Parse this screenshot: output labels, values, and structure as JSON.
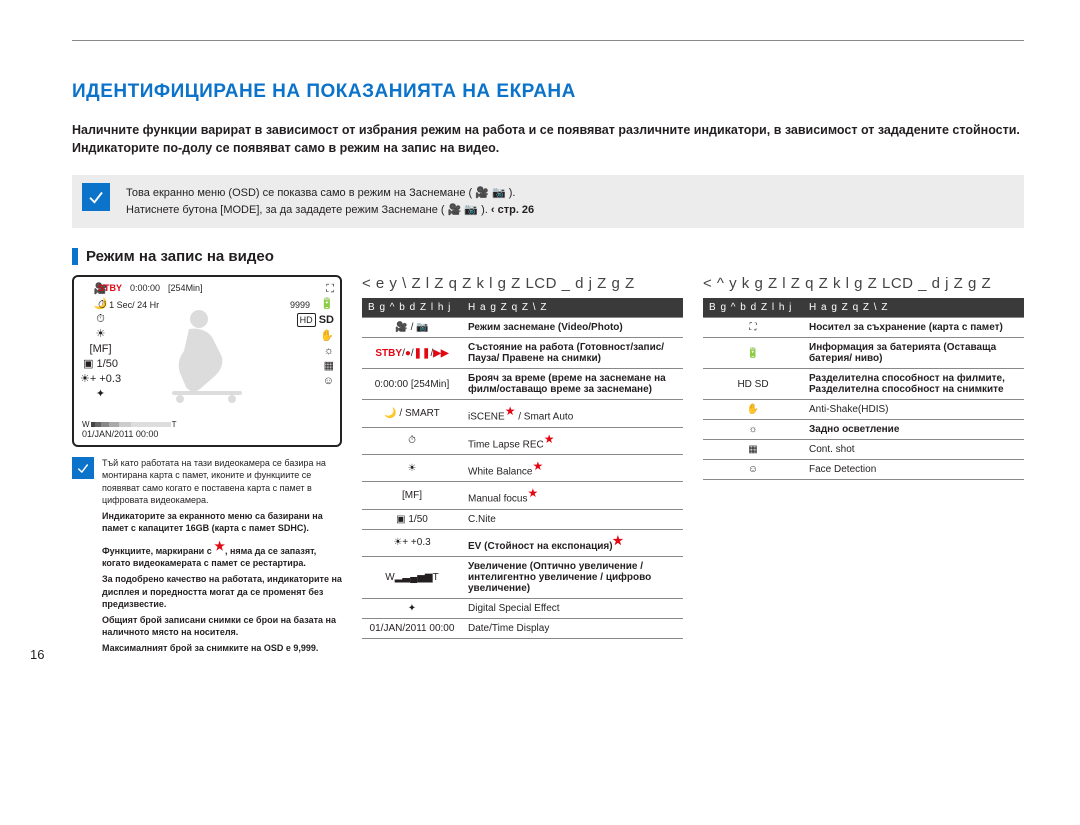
{
  "title": "ИДЕНТИФИЦИРАНЕ НА ПОКАЗАНИЯТА НА ЕКРАНА",
  "intro": "Наличните функции варират в зависимост от избрания режим на работа и се появяват различните индикатори, в зависимост от зададените стойности. Индикаторите по-долу се появяват само в режим на запис на видео.",
  "note1_line1": "Това екранно меню (OSD) се показва само в режим на Заснемане ( 🎥 📷 ).",
  "note1_line2_a": "Натиснете бутона [MODE], за да зададете режим Заснемане ( 🎥 📷 ).  ",
  "note1_line2_b": "‹ стр. 26",
  "section_head": "Режим на запис на видео",
  "lcd": {
    "stby": "STBY",
    "time": "0:00:00",
    "remain": "[254Min]",
    "rate": "1 Sec/ 24 Hr",
    "photos": "9999",
    "shutter": "1/50",
    "ev": "+0.3",
    "w": "W",
    "t": "T",
    "date": "01/JAN/2011 00:00",
    "ev_icon": "☀+"
  },
  "small_notes": [
    "Тъй като работата на тази видеокамера се базира на монтирана карта с памет, иконите и функциите се появяват само когато е поставена карта с памет в цифровата видеокамера.",
    "Индикаторите за екранното меню са базирани на памет с капацитет 16GB (карта с памет SDHC).",
    "Функциите, маркирани с ★, няма да се запазят, когато видеокамерата с памет се рестартира.",
    "За подобрено качество на работата, индикаторите на дисплея и поредността могат да се променят без предизвестие.",
    "Общият брой записани снимки се брои на базата на наличното място на носителя.",
    "Максималният брой за снимките на OSD е 9,999."
  ],
  "mid_head": "< e y \\ Z l Z q Z k l g Z LCD _ d j Z g Z",
  "right_head": "< ^ y k g Z l Z q Z k l g Z LCD _ d j Z g Z",
  "th1": "B g ^ b d Z l h j",
  "th2": "H a g Z q Z \\ Z",
  "left_table": [
    {
      "i": "🎥 / 📷",
      "d": "Режим заснемане (Video/Photo)",
      "bold_desc": true,
      "bold_sub": "(Video/Photo)"
    },
    {
      "i": "STBY/●/❚❚/▶▶",
      "d": "Състояние на работа (Готовност/запис/Пауза/ Правене на снимки)",
      "red_icon": true,
      "bold_desc": true
    },
    {
      "i": "0:00:00 [254Min]",
      "d": "Брояч за време (време на заснемане на филм/оставащо време за заснемане)",
      "bold_desc": true
    },
    {
      "i": "🌙 / SMART",
      "d": "iSCENE★ / Smart Auto",
      "star": true
    },
    {
      "i": "⏱",
      "d": "Time Lapse REC★",
      "star": true
    },
    {
      "i": "☀",
      "d": "White Balance★",
      "star": true
    },
    {
      "i": "[MF]",
      "d": "Manual focus★",
      "star": true
    },
    {
      "i": "▣ 1/50",
      "d": "C.Nite"
    },
    {
      "i": "☀+ +0.3",
      "d": "EV (Стойност на експонация)★",
      "star": true,
      "bold_desc": true
    },
    {
      "i": "W▂▃▄▅▆T",
      "d": "Увеличение (Оптично увеличение / интелигентно увеличение / цифрово увеличение)",
      "bold_desc": true
    },
    {
      "i": "✦",
      "d": "Digital Special Effect"
    },
    {
      "i": "01/JAN/2011 00:00",
      "d": "Date/Time Display"
    }
  ],
  "right_table": [
    {
      "i": "⛶",
      "d": "Носител за съхранение (карта с памет)",
      "bold_desc": true
    },
    {
      "i": "🔋",
      "d": "Информация за батерията (Оставаща батерия/ ниво)",
      "bold_desc": true
    },
    {
      "i": "HD  SD",
      "d": "Разделителна способност на филмите, Разделителна способност на снимките",
      "bold_desc": true
    },
    {
      "i": "✋",
      "d": "Anti-Shake(HDIS)"
    },
    {
      "i": "☼",
      "d": "Задно осветление",
      "bold_desc": true
    },
    {
      "i": "▦",
      "d": "Cont. shot"
    },
    {
      "i": "☺",
      "d": "Face Detection"
    }
  ],
  "page_num": "16"
}
